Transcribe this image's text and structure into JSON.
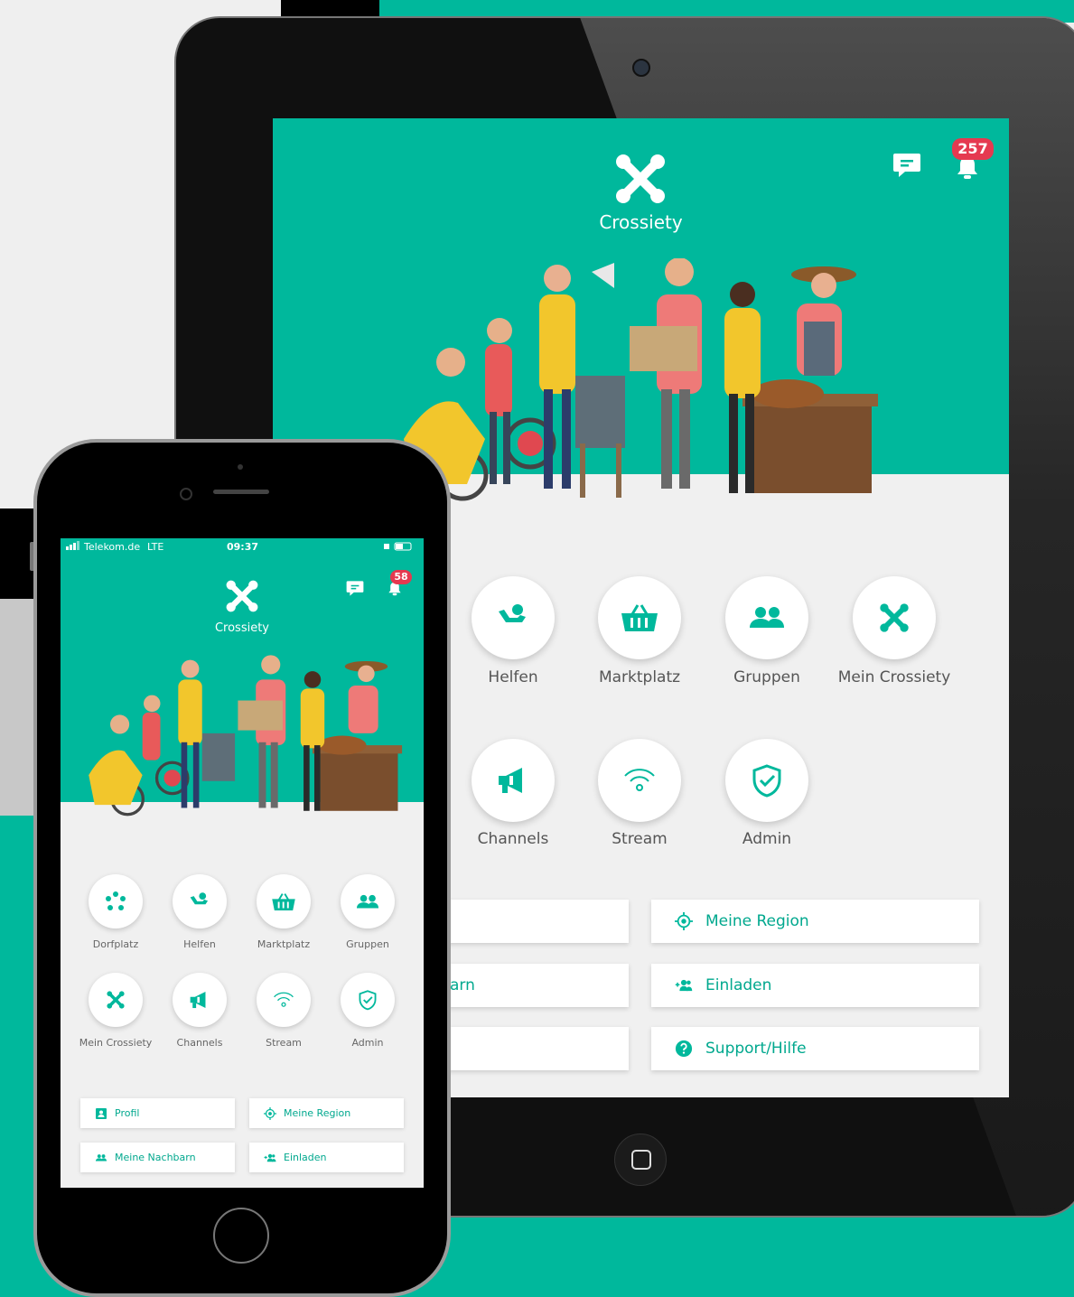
{
  "colors": {
    "brand": "#00b89c",
    "badge": "#e53950",
    "accent_text": "#00a88e"
  },
  "tablet": {
    "app_title": "Crossiety",
    "notification_count": "257",
    "tiles": [
      {
        "label": "Helfen",
        "icon": "helping-hand-icon"
      },
      {
        "label": "Marktplatz",
        "icon": "basket-icon"
      },
      {
        "label": "Gruppen",
        "icon": "group-icon"
      },
      {
        "label": "Mein Crossiety",
        "icon": "crossiety-logo-icon"
      },
      {
        "label": "Channels",
        "icon": "megaphone-icon"
      },
      {
        "label": "Stream",
        "icon": "wifi-stream-icon"
      },
      {
        "label": "Admin",
        "icon": "shield-check-icon"
      }
    ],
    "buttons_left_partial": [
      "",
      "arn",
      ""
    ],
    "buttons_right": [
      {
        "label": "Meine Region",
        "icon": "location-target-icon"
      },
      {
        "label": "Einladen",
        "icon": "add-user-icon"
      },
      {
        "label": "Support/Hilfe",
        "icon": "help-circle-icon"
      }
    ]
  },
  "phone": {
    "status": {
      "carrier": "Telekom.de",
      "network": "LTE",
      "time": "09:37"
    },
    "app_title": "Crossiety",
    "notification_count": "58",
    "tiles": [
      {
        "label": "Dorfplatz",
        "icon": "village-square-icon"
      },
      {
        "label": "Helfen",
        "icon": "helping-hand-icon"
      },
      {
        "label": "Marktplatz",
        "icon": "basket-icon"
      },
      {
        "label": "Gruppen",
        "icon": "group-icon"
      },
      {
        "label": "Mein Crossiety",
        "icon": "crossiety-logo-icon"
      },
      {
        "label": "Channels",
        "icon": "megaphone-icon"
      },
      {
        "label": "Stream",
        "icon": "wifi-stream-icon"
      },
      {
        "label": "Admin",
        "icon": "shield-check-icon"
      }
    ],
    "buttons": [
      {
        "label": "Profil",
        "icon": "profile-card-icon"
      },
      {
        "label": "Meine Region",
        "icon": "location-target-icon"
      },
      {
        "label": "Meine Nachbarn",
        "icon": "neighbors-icon"
      },
      {
        "label": "Einladen",
        "icon": "add-user-icon"
      }
    ]
  }
}
